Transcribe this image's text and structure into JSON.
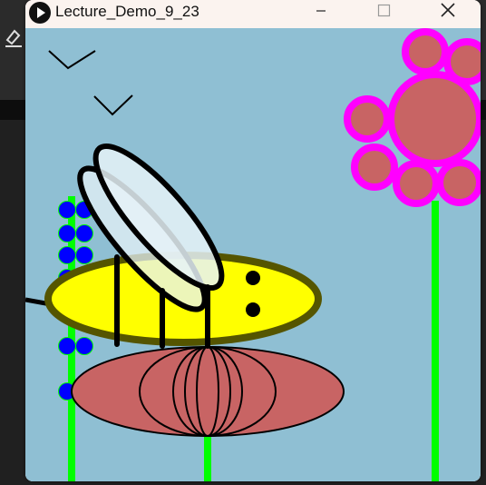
{
  "window": {
    "title": "Lecture_Demo_9_23",
    "buttons": [
      "minimize",
      "maximize",
      "close"
    ]
  },
  "colors": {
    "sky": "#8fbfd3",
    "stem": "#00ff00",
    "pink_petal_ring": "#ff00ff",
    "petal_fill": "#c86464",
    "blue_flower": "#0000ff",
    "bee_body": "#ffff00",
    "bee_outline": "#555500",
    "wing_fill": "#e6f2f7",
    "titlebar": "#fbf3ef"
  },
  "icons": {
    "app": "play-icon",
    "minimize": "minimize-icon",
    "maximize": "maximize-icon",
    "close": "close-icon"
  }
}
